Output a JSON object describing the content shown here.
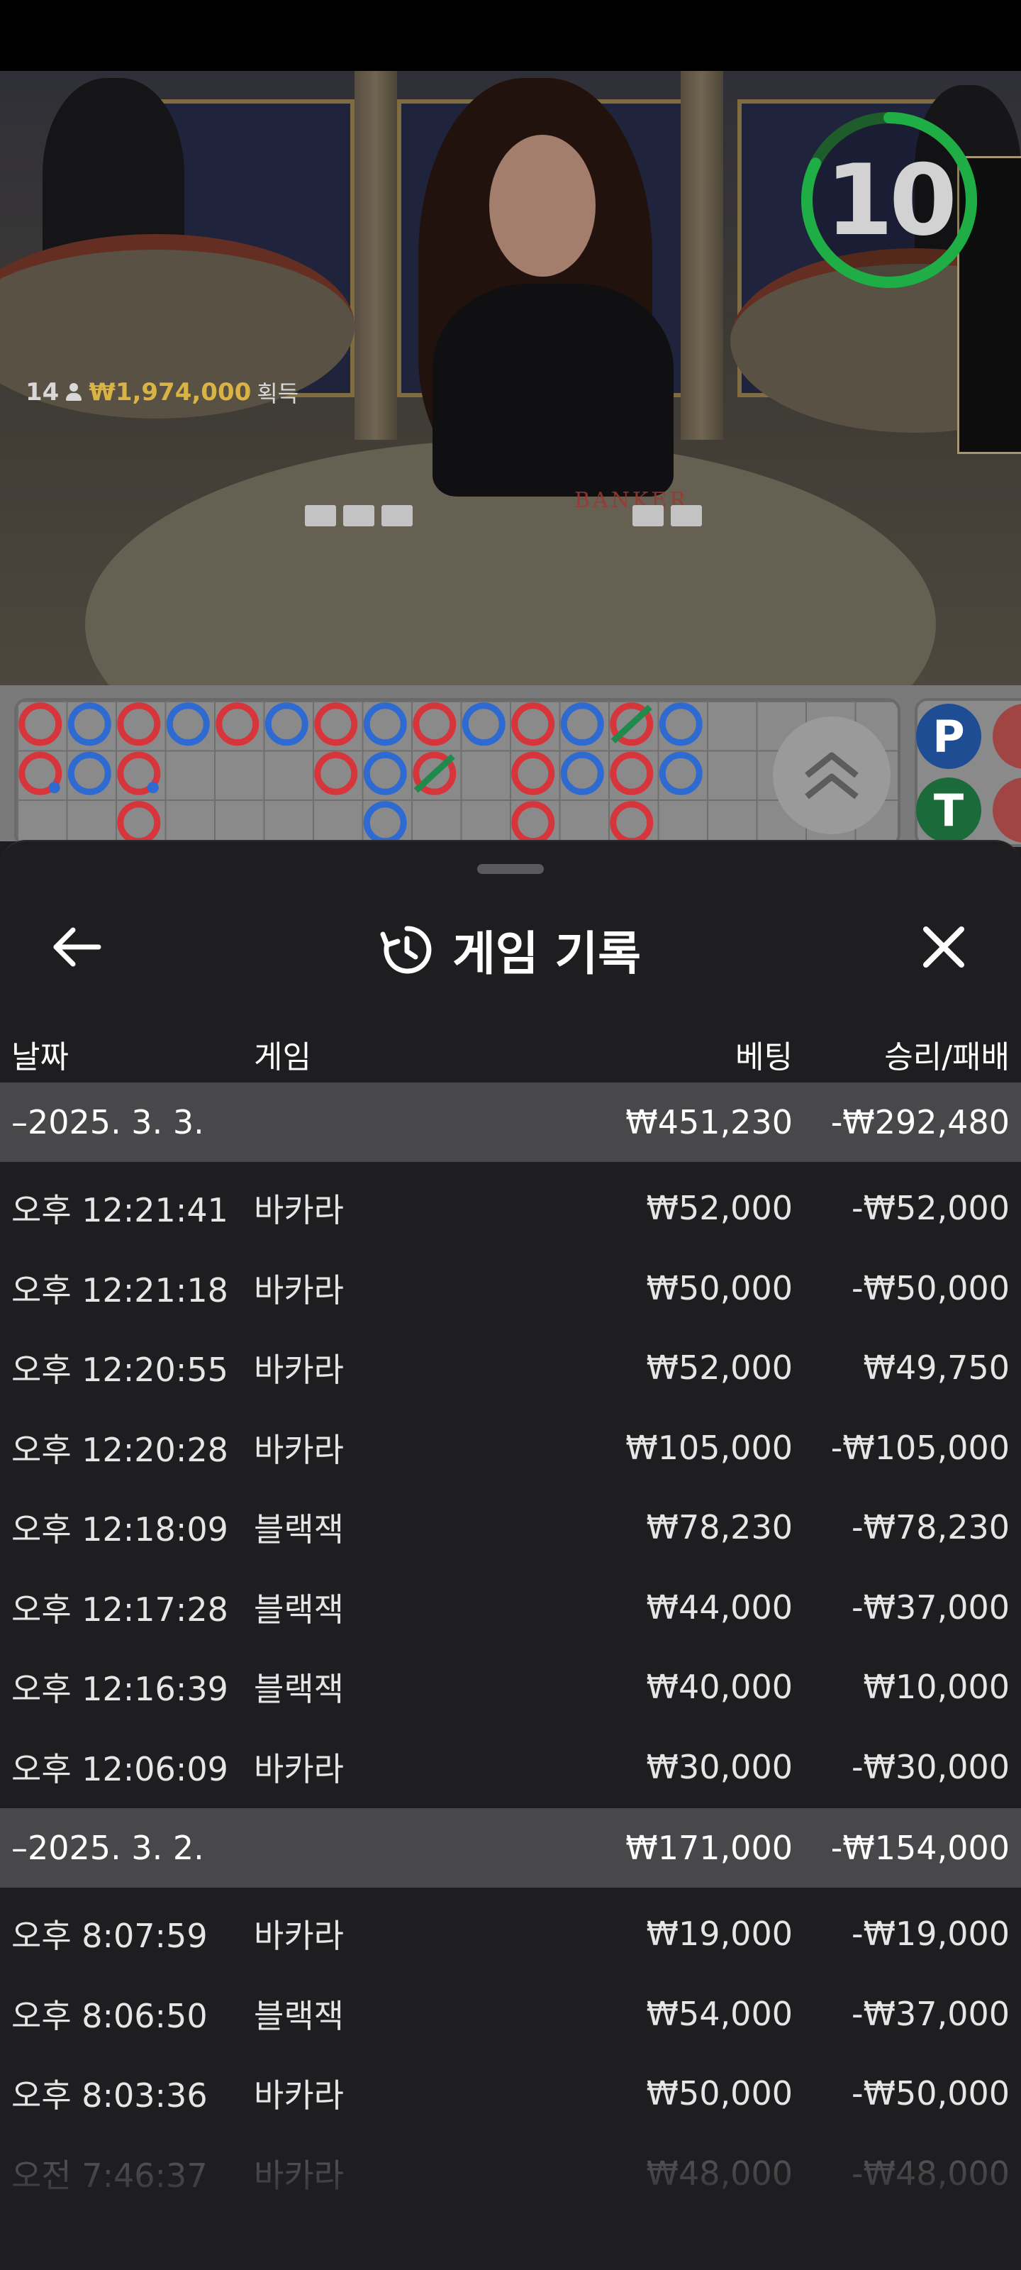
{
  "video": {
    "winner_count": "14",
    "win_amount": "₩1,974,000",
    "win_label": "획득",
    "timer": "10",
    "table_label": "BANKER"
  },
  "road": {
    "row1": [
      "B",
      "P",
      "B",
      "P",
      "B",
      "P",
      "B",
      "P",
      "B",
      "P",
      "B",
      "P",
      "BT",
      "P"
    ],
    "row2": [
      "Bp",
      "P",
      "Bp",
      "",
      "",
      "",
      "B",
      "P",
      "BT",
      "",
      "B",
      "P",
      "B",
      "P"
    ],
    "row3": [
      "",
      "",
      "B",
      "",
      "",
      "",
      "",
      "P",
      "",
      "",
      "B",
      "",
      "B",
      ""
    ],
    "colors": {
      "banker": "#d6353b",
      "player": "#2f6ad0",
      "tie": "#1f8a4c"
    }
  },
  "predict": {
    "player_letter": "P",
    "tie_letter": "T"
  },
  "sheet": {
    "title": "게임 기록",
    "title_icon": "history-icon",
    "back_icon": "arrow-left-icon",
    "close_icon": "close-icon"
  },
  "columns": {
    "date": "날짜",
    "game": "게임",
    "bet": "베팅",
    "result": "승리/패배"
  },
  "groups": [
    {
      "date": "–2025. 3. 3.",
      "bet_total": "₩451,230",
      "result_total": "-₩292,480",
      "rows": [
        {
          "time": "오후 12:21:41",
          "game": "바카라",
          "bet": "₩52,000",
          "result": "-₩52,000"
        },
        {
          "time": "오후 12:21:18",
          "game": "바카라",
          "bet": "₩50,000",
          "result": "-₩50,000"
        },
        {
          "time": "오후 12:20:55",
          "game": "바카라",
          "bet": "₩52,000",
          "result": "₩49,750"
        },
        {
          "time": "오후 12:20:28",
          "game": "바카라",
          "bet": "₩105,000",
          "result": "-₩105,000"
        },
        {
          "time": "오후 12:18:09",
          "game": "블랙잭",
          "bet": "₩78,230",
          "result": "-₩78,230"
        },
        {
          "time": "오후 12:17:28",
          "game": "블랙잭",
          "bet": "₩44,000",
          "result": "-₩37,000"
        },
        {
          "time": "오후 12:16:39",
          "game": "블랙잭",
          "bet": "₩40,000",
          "result": "₩10,000"
        },
        {
          "time": "오후 12:06:09",
          "game": "바카라",
          "bet": "₩30,000",
          "result": "-₩30,000"
        }
      ]
    },
    {
      "date": "–2025. 3. 2.",
      "bet_total": "₩171,000",
      "result_total": "-₩154,000",
      "rows": [
        {
          "time": "오후 8:07:59",
          "game": "바카라",
          "bet": "₩19,000",
          "result": "-₩19,000"
        },
        {
          "time": "오후 8:06:50",
          "game": "블랙잭",
          "bet": "₩54,000",
          "result": "-₩37,000"
        },
        {
          "time": "오후 8:03:36",
          "game": "바카라",
          "bet": "₩50,000",
          "result": "-₩50,000"
        },
        {
          "time": "오전 7:46:37",
          "game": "바카라",
          "bet": "₩48,000",
          "result": "-₩48,000"
        }
      ]
    }
  ]
}
